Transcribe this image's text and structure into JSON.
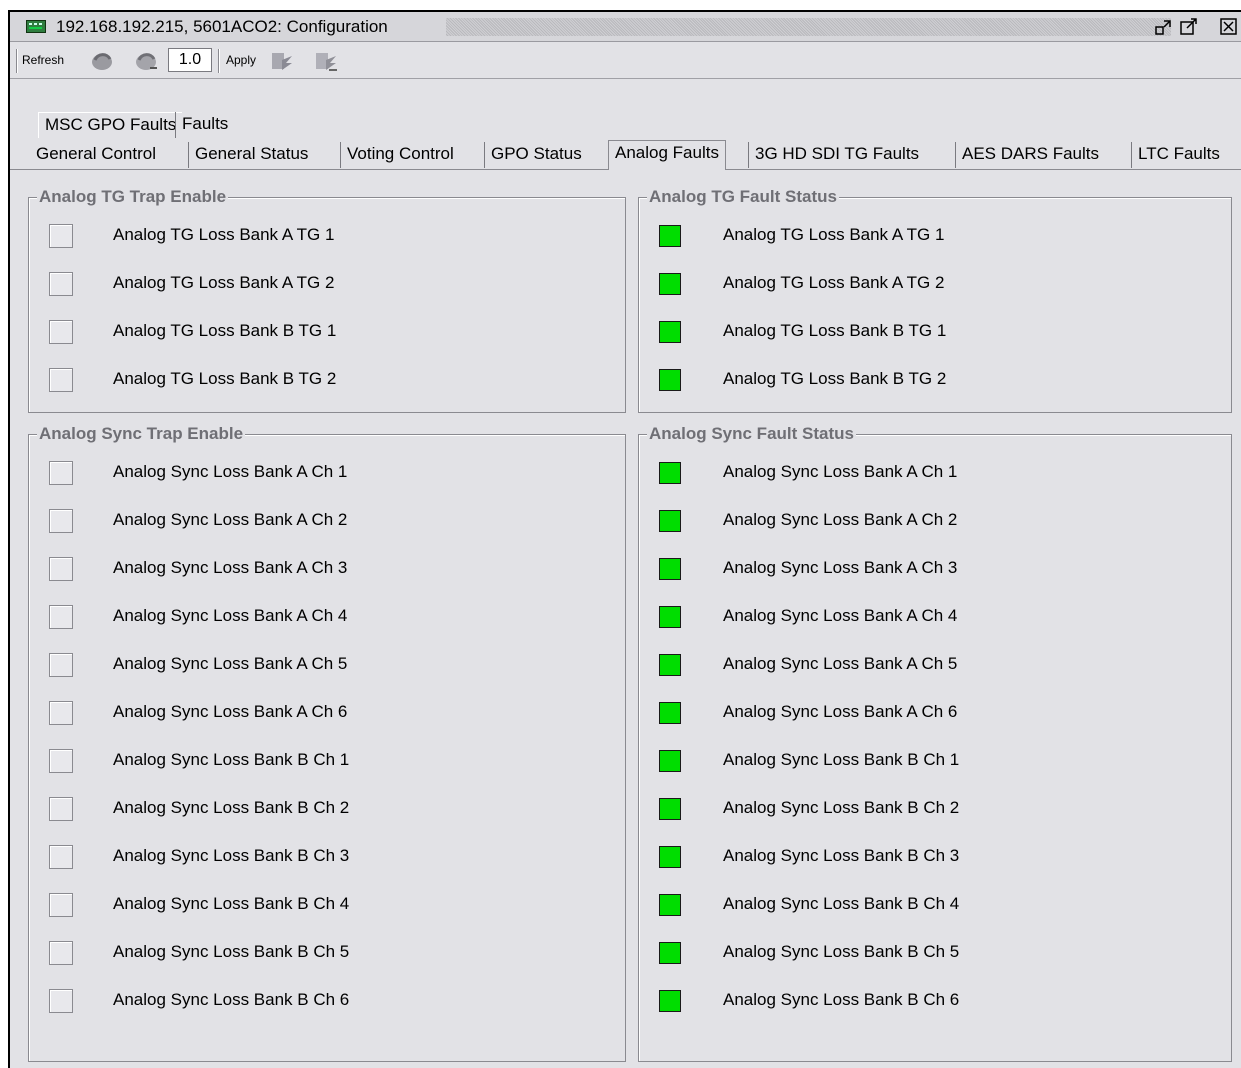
{
  "window": {
    "title": "192.168.192.215, 5601ACO2: Configuration",
    "icons": [
      "device-icon",
      "restore-icon",
      "maximize-icon",
      "close-icon"
    ]
  },
  "toolbar": {
    "refresh_label": "Refresh",
    "version_value": "1.0",
    "apply_label": "Apply"
  },
  "tabs": {
    "row1": [
      "MSC GPO Faults",
      "Faults"
    ],
    "row2": [
      "General Control",
      "General Status",
      "Voting Control",
      "GPO Status",
      "Analog Faults",
      "3G HD SDI TG Faults",
      "AES DARS Faults",
      "LTC Faults"
    ],
    "active": "Analog Faults"
  },
  "panels": {
    "tg_trap": {
      "title": "Analog TG Trap Enable",
      "items": [
        "Analog TG Loss Bank A TG 1",
        "Analog TG Loss Bank A TG 2",
        "Analog TG Loss Bank B TG 1",
        "Analog TG Loss Bank B TG 2"
      ]
    },
    "tg_fault": {
      "title": "Analog TG Fault Status",
      "items": [
        "Analog TG Loss Bank A TG 1",
        "Analog TG Loss Bank A TG 2",
        "Analog TG Loss Bank B TG 1",
        "Analog TG Loss Bank B TG 2"
      ],
      "status_color": "#00dd00"
    },
    "sync_trap": {
      "title": "Analog Sync Trap Enable",
      "items": [
        "Analog Sync Loss Bank A Ch 1",
        "Analog Sync Loss Bank A Ch 2",
        "Analog Sync Loss Bank A Ch 3",
        "Analog Sync Loss Bank A Ch 4",
        "Analog Sync Loss Bank A Ch 5",
        "Analog Sync Loss Bank A Ch 6",
        "Analog Sync Loss Bank B Ch 1",
        "Analog Sync Loss Bank B Ch 2",
        "Analog Sync Loss Bank B Ch 3",
        "Analog Sync Loss Bank B Ch 4",
        "Analog Sync Loss Bank B Ch 5",
        "Analog Sync Loss Bank B Ch 6"
      ]
    },
    "sync_fault": {
      "title": "Analog Sync Fault Status",
      "items": [
        "Analog Sync Loss Bank A Ch 1",
        "Analog Sync Loss Bank A Ch 2",
        "Analog Sync Loss Bank A Ch 3",
        "Analog Sync Loss Bank A Ch 4",
        "Analog Sync Loss Bank A Ch 5",
        "Analog Sync Loss Bank A Ch 6",
        "Analog Sync Loss Bank B Ch 1",
        "Analog Sync Loss Bank B Ch 2",
        "Analog Sync Loss Bank B Ch 3",
        "Analog Sync Loss Bank B Ch 4",
        "Analog Sync Loss Bank B Ch 5",
        "Analog Sync Loss Bank B Ch 6"
      ],
      "status_color": "#00dd00"
    }
  }
}
